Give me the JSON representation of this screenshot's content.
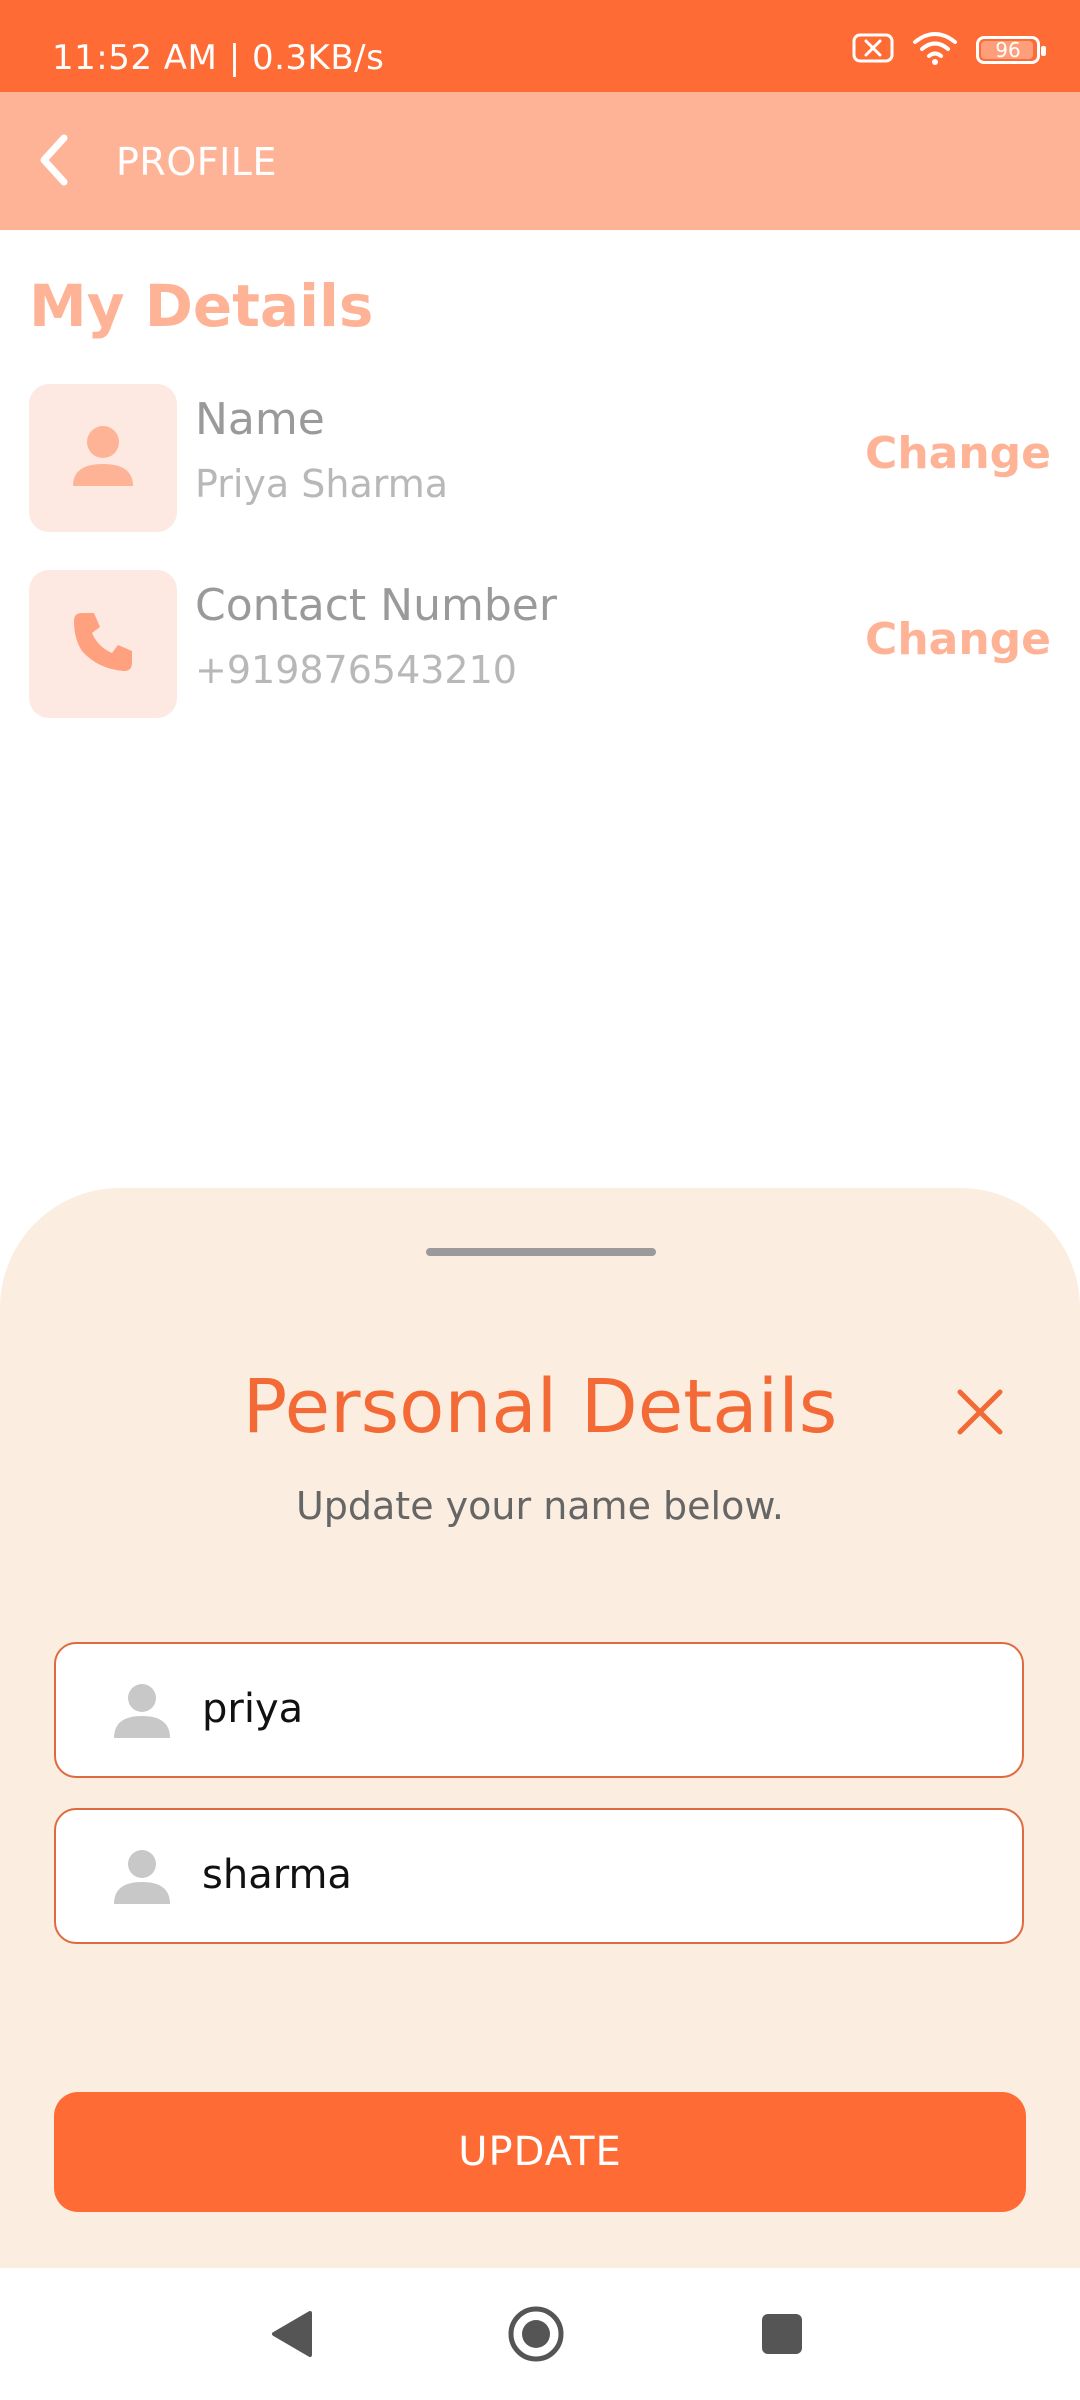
{
  "status_bar": {
    "time": "11:52 AM | 0.3KB/s",
    "battery": "96",
    "icons": [
      "screenshot-x-icon",
      "wifi-icon",
      "battery-icon"
    ]
  },
  "app_bar": {
    "title": "PROFILE",
    "back_icon": "chevron-left-icon"
  },
  "details": {
    "title": "My Details",
    "rows": [
      {
        "label": "Name",
        "value": "Priya Sharma",
        "action": "Change",
        "icon": "person-icon"
      },
      {
        "label": "Contact Number",
        "value": "+919876543210",
        "action": "Change",
        "icon": "phone-icon"
      }
    ]
  },
  "sheet": {
    "title": "Personal Details",
    "subtitle": "Update your name below.",
    "fields": [
      {
        "value": "priya",
        "icon": "person-icon"
      },
      {
        "value": "sharma",
        "icon": "person-icon"
      }
    ],
    "button_label": "UPDATE"
  },
  "colors": {
    "primary": "#FF6B35",
    "app_bar": "#FFB396",
    "sheet_bg": "#FBEEE0",
    "accent_text": "#F36A36"
  }
}
